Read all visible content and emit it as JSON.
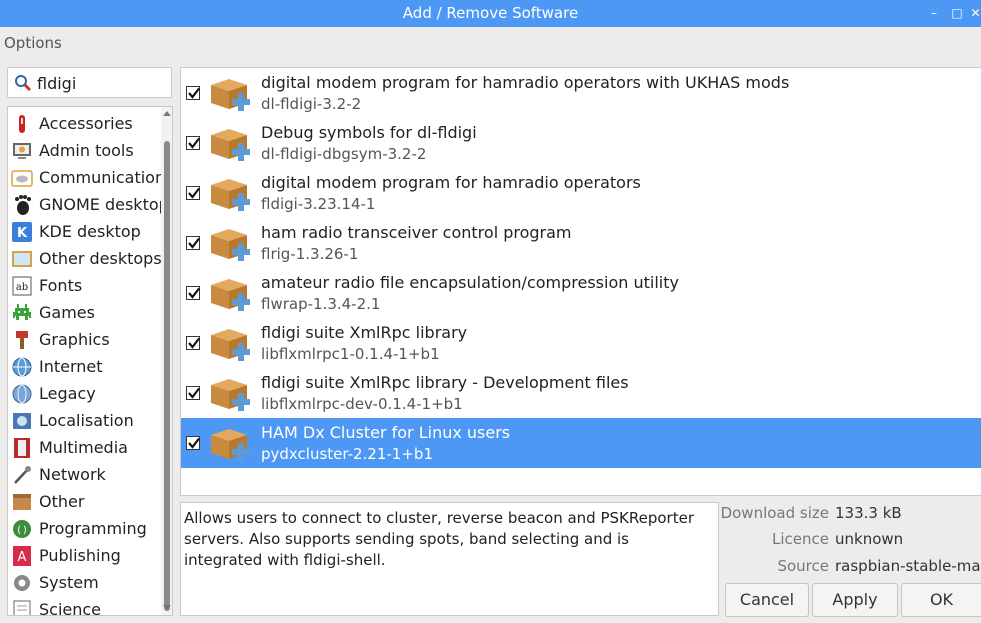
{
  "window": {
    "title": "Add / Remove Software",
    "minimize_glyph": "–",
    "maximize_glyph": "□",
    "close_glyph": "✕"
  },
  "menubar": {
    "options_label": "Options"
  },
  "search": {
    "value": "fldigi",
    "icon": "search-icon"
  },
  "categories": [
    {
      "label": "Accessories",
      "icon": "swiss-knife-icon"
    },
    {
      "label": "Admin tools",
      "icon": "admin-monitor-icon"
    },
    {
      "label": "Communication",
      "icon": "cloud-icon"
    },
    {
      "label": "GNOME desktop",
      "icon": "gnome-foot-icon"
    },
    {
      "label": "KDE desktop",
      "icon": "kde-gear-icon"
    },
    {
      "label": "Other desktops",
      "icon": "desktop-icon"
    },
    {
      "label": "Fonts",
      "icon": "font-icon"
    },
    {
      "label": "Games",
      "icon": "invader-icon"
    },
    {
      "label": "Graphics",
      "icon": "paintbrush-icon"
    },
    {
      "label": "Internet",
      "icon": "globe-icon"
    },
    {
      "label": "Legacy",
      "icon": "legacy-globe-icon"
    },
    {
      "label": "Localisation",
      "icon": "localisation-icon"
    },
    {
      "label": "Multimedia",
      "icon": "film-icon"
    },
    {
      "label": "Network",
      "icon": "network-icon"
    },
    {
      "label": "Other",
      "icon": "box-icon"
    },
    {
      "label": "Programming",
      "icon": "programming-icon"
    },
    {
      "label": "Publishing",
      "icon": "publishing-icon"
    },
    {
      "label": "System",
      "icon": "system-gear-icon"
    },
    {
      "label": "Science",
      "icon": "science-icon"
    }
  ],
  "packages": [
    {
      "description": "digital modem program for hamradio operators with UKHAS mods",
      "version": "dl-fldigi-3.2-2",
      "checked": true,
      "selected": false
    },
    {
      "description": "Debug symbols for dl-fldigi",
      "version": "dl-fldigi-dbgsym-3.2-2",
      "checked": true,
      "selected": false
    },
    {
      "description": "digital modem program for hamradio operators",
      "version": "fldigi-3.23.14-1",
      "checked": true,
      "selected": false
    },
    {
      "description": "ham radio transceiver control program",
      "version": "flrig-1.3.26-1",
      "checked": true,
      "selected": false
    },
    {
      "description": "amateur radio file encapsulation/compression utility",
      "version": "flwrap-1.3.4-2.1",
      "checked": true,
      "selected": false
    },
    {
      "description": "fldigi suite XmlRpc library",
      "version": "libflxmlrpc1-0.1.4-1+b1",
      "checked": true,
      "selected": false
    },
    {
      "description": "fldigi suite XmlRpc library - Development files",
      "version": "libflxmlrpc-dev-0.1.4-1+b1",
      "checked": true,
      "selected": false
    },
    {
      "description": "HAM Dx Cluster for Linux users",
      "version": "pydxcluster-2.21-1+b1",
      "checked": true,
      "selected": true
    }
  ],
  "details": {
    "text": "Allows users to connect to cluster, reverse beacon and PSKReporter servers. Also supports sending spots, band selecting and is integrated with fldigi-shell."
  },
  "info": [
    {
      "key": "Download size",
      "value": "133.3 kB"
    },
    {
      "key": "Licence",
      "value": "unknown"
    },
    {
      "key": "Source",
      "value": "raspbian-stable-main"
    }
  ],
  "buttons": {
    "cancel": "Cancel",
    "apply": "Apply",
    "ok": "OK"
  },
  "colors": {
    "titlebar": "#4d98f5",
    "selection": "#4d98f5",
    "window_bg": "#edeceb"
  }
}
